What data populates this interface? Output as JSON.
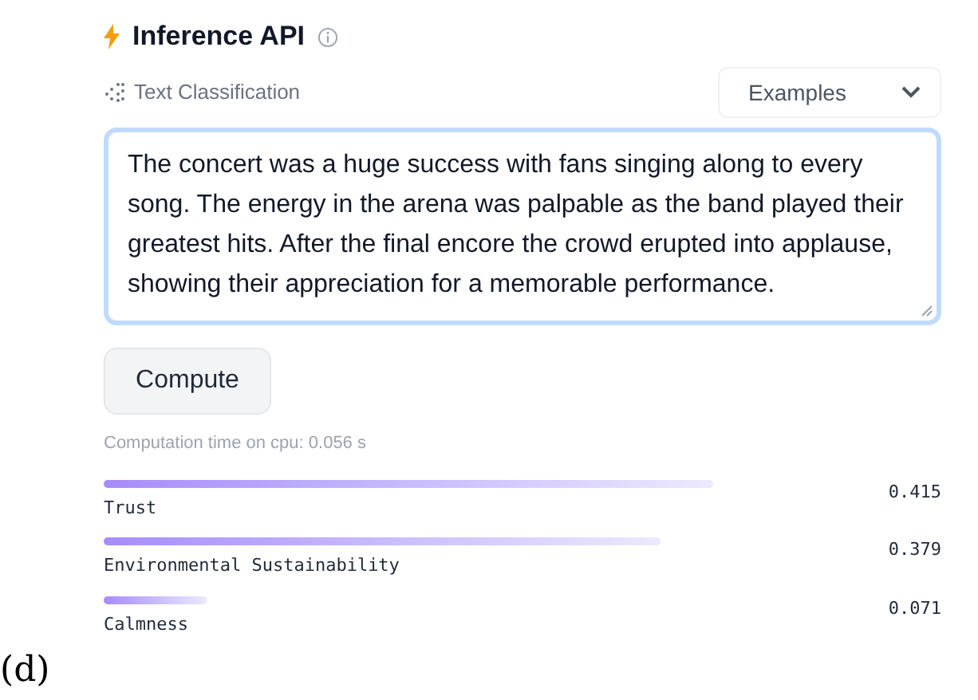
{
  "figure_label": "(d)",
  "widget": {
    "title": "Inference API",
    "task": "Text Classification",
    "examples_button": "Examples",
    "input_text": "The concert was a huge success with fans singing along to every song. The energy in the arena was palpable as the band played their greatest hits. After the final encore the crowd erupted into applause, showing their appreciation for a memorable performance.",
    "compute_button": "Compute",
    "computation_time": "Computation time on cpu: 0.056 s",
    "results": [
      {
        "label": "Trust",
        "score": "0.415"
      },
      {
        "label": "Environmental Sustainability",
        "score": "0.379"
      },
      {
        "label": "Calmness",
        "score": "0.071"
      }
    ]
  }
}
